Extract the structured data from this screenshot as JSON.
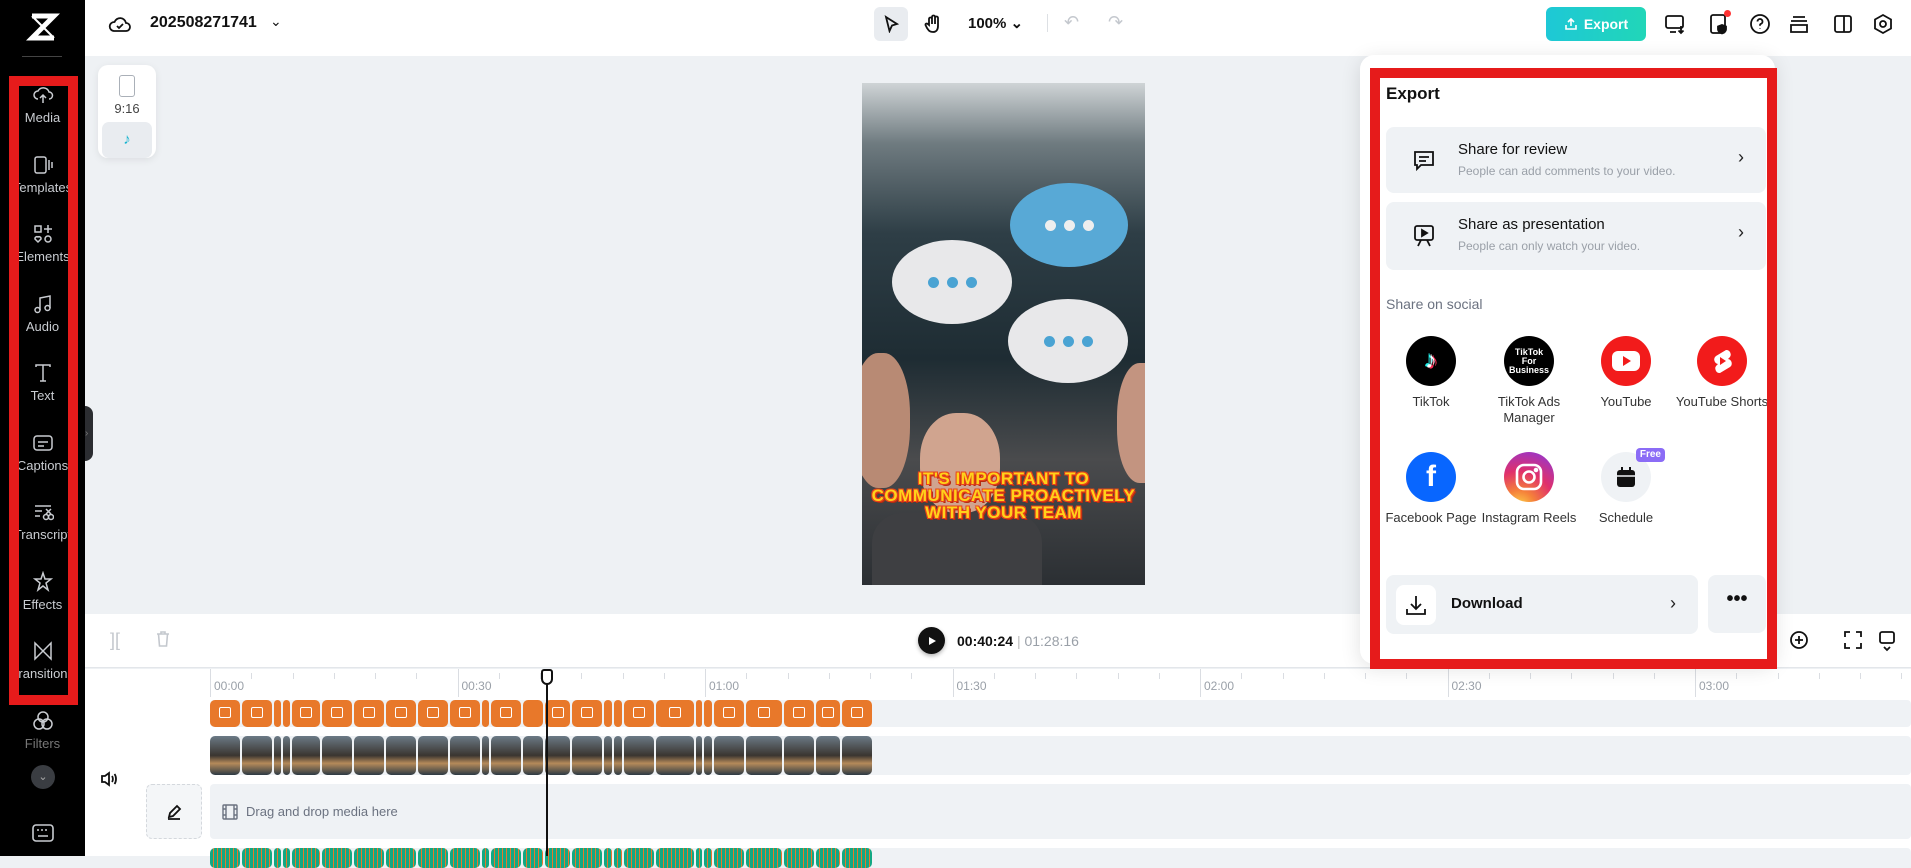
{
  "sidebar": {
    "items": [
      {
        "id": "media",
        "label": "Media"
      },
      {
        "id": "templates",
        "label": "Templates"
      },
      {
        "id": "elements",
        "label": "Elements"
      },
      {
        "id": "audio",
        "label": "Audio"
      },
      {
        "id": "text",
        "label": "Text"
      },
      {
        "id": "captions",
        "label": "Captions"
      },
      {
        "id": "transcript",
        "label": "Transcript"
      },
      {
        "id": "effects",
        "label": "Effects"
      },
      {
        "id": "transitions",
        "label": "Transitions"
      },
      {
        "id": "filters",
        "label": "Filters"
      }
    ]
  },
  "header": {
    "project_name": "202508271741",
    "zoom": "100%",
    "export_label": "Export"
  },
  "ratio": {
    "label": "9:16"
  },
  "preview": {
    "caption": "IT'S IMPORTANT TO COMMUNICATE PROACTIVELY WITH YOUR TEAM"
  },
  "export_panel": {
    "title": "Export",
    "share_review": {
      "title": "Share for review",
      "subtitle": "People can add comments to your video."
    },
    "share_presentation": {
      "title": "Share as presentation",
      "subtitle": "People can only watch your video."
    },
    "social_heading": "Share on social",
    "social": [
      {
        "id": "tiktok",
        "label": "TikTok"
      },
      {
        "id": "tiktok-ads",
        "label": "TikTok Ads Manager",
        "logo_text": "TikTok For Business"
      },
      {
        "id": "youtube",
        "label": "YouTube"
      },
      {
        "id": "youtube-shorts",
        "label": "YouTube Shorts"
      },
      {
        "id": "facebook",
        "label": "Facebook Page"
      },
      {
        "id": "instagram",
        "label": "Instagram Reels"
      },
      {
        "id": "schedule",
        "label": "Schedule",
        "badge": "Free"
      }
    ],
    "download_label": "Download"
  },
  "playback": {
    "current": "00:40:24",
    "separator": "|",
    "total": "01:28:16",
    "progress_seconds": 40.8,
    "total_seconds": 88.5
  },
  "timeline": {
    "ticks": [
      "00:00",
      "00:30",
      "01:00",
      "01:30",
      "02:00",
      "02:30",
      "03:00"
    ],
    "drop_placeholder": "Drag and drop media here"
  },
  "colors": {
    "accent": "#1ec8d6",
    "caption_clip": "#e8782a",
    "audio_clip": "#12a883",
    "highlight": "#e61b1b"
  }
}
